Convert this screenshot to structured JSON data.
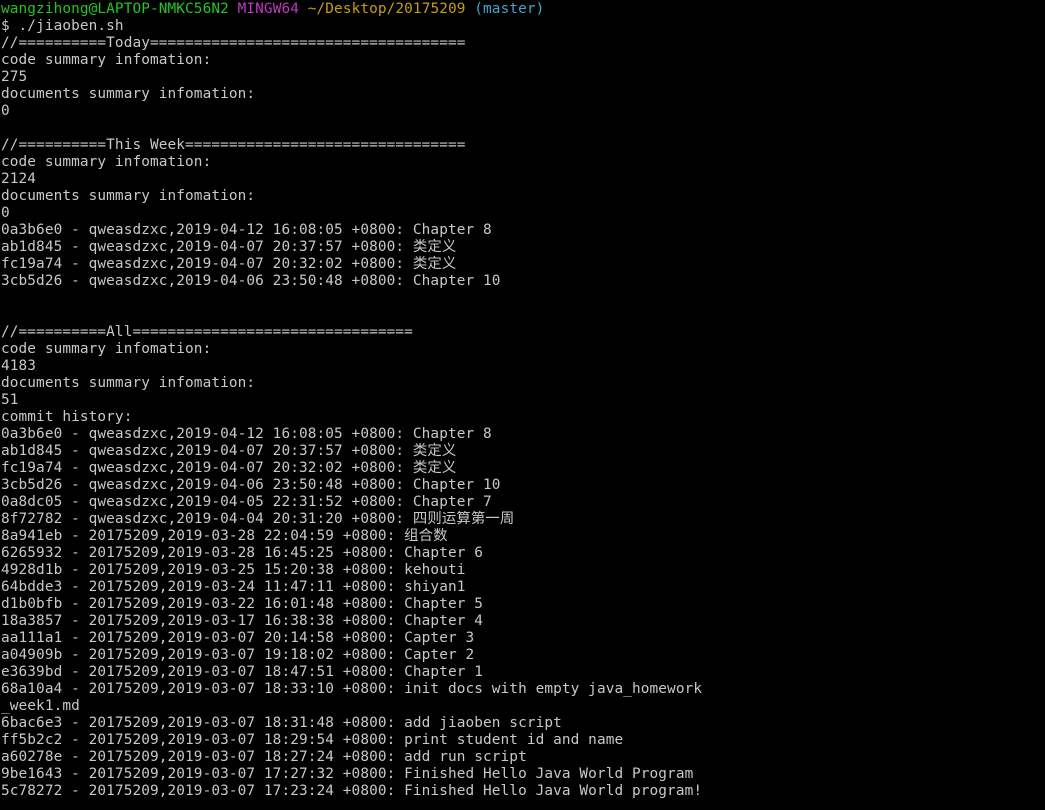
{
  "colors": {
    "background": "#000000",
    "text": "#c8c8c8",
    "prompt_user": "#1ec81e",
    "prompt_env": "#c036c0",
    "prompt_path": "#c4a000",
    "prompt_branch": "#3ba8c8"
  },
  "prompt": {
    "user_host": "wangzihong@LAPTOP-NMKC56N2",
    "env": "MINGW64",
    "path": "~/Desktop/20175209",
    "branch": "(master)",
    "command": "$ ./jiaoben.sh"
  },
  "lines": [
    "//==========Today====================================",
    "code summary infomation:",
    "275",
    "documents summary infomation:",
    "0",
    "",
    "//==========This Week================================",
    "code summary infomation:",
    "2124",
    "documents summary infomation:",
    "0",
    "0a3b6e0 - qweasdzxc,2019-04-12 16:08:05 +0800: Chapter 8",
    "ab1d845 - qweasdzxc,2019-04-07 20:37:57 +0800: 类定义",
    "fc19a74 - qweasdzxc,2019-04-07 20:32:02 +0800: 类定义",
    "3cb5d26 - qweasdzxc,2019-04-06 23:50:48 +0800: Chapter 10",
    "",
    "",
    "//==========All================================",
    "code summary infomation:",
    "4183",
    "documents summary infomation:",
    "51",
    "commit history:",
    "0a3b6e0 - qweasdzxc,2019-04-12 16:08:05 +0800: Chapter 8",
    "ab1d845 - qweasdzxc,2019-04-07 20:37:57 +0800: 类定义",
    "fc19a74 - qweasdzxc,2019-04-07 20:32:02 +0800: 类定义",
    "3cb5d26 - qweasdzxc,2019-04-06 23:50:48 +0800: Chapter 10",
    "0a8dc05 - qweasdzxc,2019-04-05 22:31:52 +0800: Chapter 7",
    "8f72782 - qweasdzxc,2019-04-04 20:31:20 +0800: 四则运算第一周",
    "8a941eb - 20175209,2019-03-28 22:04:59 +0800: 组合数",
    "6265932 - 20175209,2019-03-28 16:45:25 +0800: Chapter 6",
    "4928d1b - 20175209,2019-03-25 15:20:38 +0800: kehouti",
    "64bdde3 - 20175209,2019-03-24 11:47:11 +0800: shiyan1",
    "d1b0bfb - 20175209,2019-03-22 16:01:48 +0800: Chapter 5",
    "18a3857 - 20175209,2019-03-17 16:38:38 +0800: Chapter 4",
    "aa111a1 - 20175209,2019-03-07 20:14:58 +0800: Capter 3",
    "a04909b - 20175209,2019-03-07 19:18:02 +0800: Capter 2",
    "e3639bd - 20175209,2019-03-07 18:47:51 +0800: Chapter 1",
    "68a10a4 - 20175209,2019-03-07 18:33:10 +0800: init docs with empty java_homework",
    "_week1.md",
    "6bac6e3 - 20175209,2019-03-07 18:31:48 +0800: add jiaoben script",
    "ff5b2c2 - 20175209,2019-03-07 18:29:54 +0800: print student id and name",
    "a60278e - 20175209,2019-03-07 18:27:24 +0800: add run script",
    "9be1643 - 20175209,2019-03-07 17:27:32 +0800: Finished Hello Java World Program",
    "5c78272 - 20175209,2019-03-07 17:23:24 +0800: Finished Hello Java World program!"
  ]
}
